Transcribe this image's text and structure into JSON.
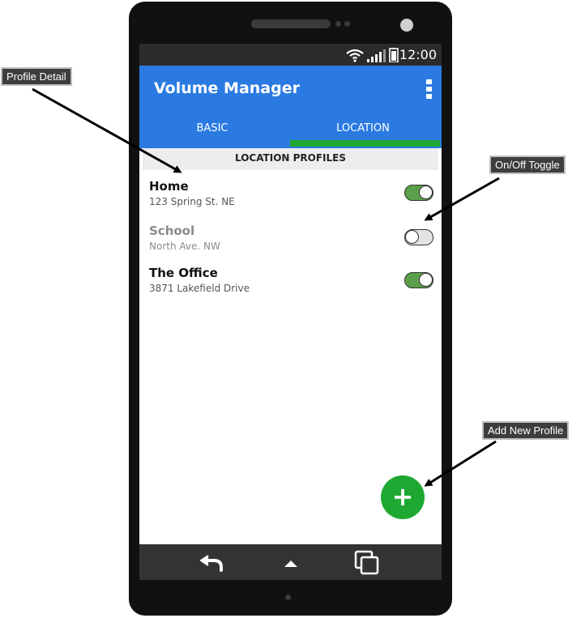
{
  "status_bar": {
    "time": "12:00",
    "icons": [
      "wifi-icon",
      "signal-icon",
      "battery-icon"
    ]
  },
  "app_bar": {
    "title": "Volume Manager",
    "menu_icon": "overflow-menu-icon"
  },
  "tabs": [
    {
      "label": "BASIC",
      "selected": false
    },
    {
      "label": "LOCATION",
      "selected": true
    }
  ],
  "section": {
    "header": "LOCATION PROFILES"
  },
  "profiles": [
    {
      "name": "Home",
      "address": "123 Spring St. NE",
      "enabled": true
    },
    {
      "name": "School",
      "address": "North Ave. NW",
      "enabled": false
    },
    {
      "name": "The Office",
      "address": "3871 Lakefield Drive",
      "enabled": true
    }
  ],
  "fab": {
    "icon": "plus-icon",
    "symbol": "+"
  },
  "nav_bar": {
    "icons": [
      "back-icon",
      "home-icon",
      "recent-apps-icon"
    ]
  },
  "annotations": [
    {
      "label": "Profile Detail"
    },
    {
      "label": "On/Off Toggle"
    },
    {
      "label": "Add New Profile"
    }
  ],
  "colors": {
    "app_bar": "#2a7ae2",
    "accent_green": "#1ea832",
    "toggle_on": "#5aa04a",
    "phone_body": "#111111",
    "nav_bar": "#333333",
    "callout_bg": "#3d3d3d"
  }
}
